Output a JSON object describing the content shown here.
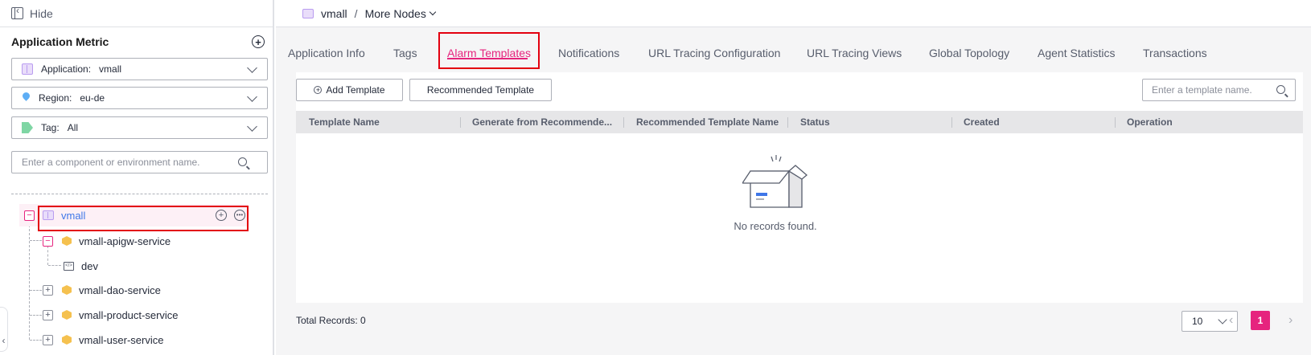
{
  "sidebar": {
    "hide_label": "Hide",
    "title": "Application Metric",
    "application": {
      "label": "Application:",
      "value": "vmall"
    },
    "region": {
      "label": "Region:",
      "value": "eu-de"
    },
    "tag": {
      "label": "Tag:",
      "value": "All"
    },
    "search_placeholder": "Enter a component or environment name.",
    "tree": {
      "root": "vmall",
      "children": [
        {
          "label": "vmall-apigw-service",
          "expanded": true,
          "children": [
            {
              "label": "dev"
            }
          ]
        },
        {
          "label": "vmall-dao-service",
          "expanded": false
        },
        {
          "label": "vmall-product-service",
          "expanded": false
        },
        {
          "label": "vmall-user-service",
          "expanded": false
        }
      ]
    }
  },
  "breadcrumb": {
    "app": "vmall",
    "separator": "/",
    "more": "More Nodes"
  },
  "tabs": [
    "Application Info",
    "Tags",
    "Alarm Templates",
    "Notifications",
    "URL Tracing Configuration",
    "URL Tracing Views",
    "Global Topology",
    "Agent Statistics",
    "Transactions"
  ],
  "active_tab": "Alarm Templates",
  "toolbar": {
    "add_label": "Add Template",
    "recommended_label": "Recommended Template",
    "search_placeholder": "Enter a template name."
  },
  "table": {
    "columns": [
      "Template Name",
      "Generate from Recommende...",
      "Recommended Template Name",
      "Status",
      "Created",
      "Operation"
    ],
    "empty_text": "No records found."
  },
  "footer": {
    "total_label": "Total Records: 0",
    "page_size": "10",
    "current_page": "1"
  },
  "colors": {
    "accent": "#e6247e",
    "highlight_box": "#e3000f"
  }
}
